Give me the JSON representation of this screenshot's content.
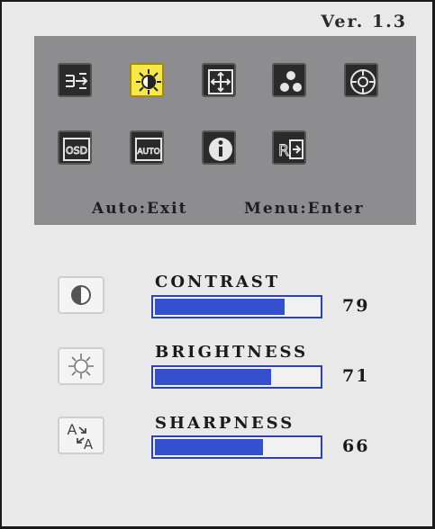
{
  "version": "Ver. 1.3",
  "menu": {
    "row1": [
      {
        "icon": "input-select-icon",
        "selected": false
      },
      {
        "icon": "picture-sun-icon",
        "selected": true
      },
      {
        "icon": "position-arrows-icon",
        "selected": false
      },
      {
        "icon": "color-dots-icon",
        "selected": false
      },
      {
        "icon": "image-setup-icon",
        "selected": false
      }
    ],
    "row2": [
      {
        "icon": "osd-setup-icon",
        "label": "OSD",
        "selected": false
      },
      {
        "icon": "auto-adjust-icon",
        "label": "AUTO",
        "selected": false
      },
      {
        "icon": "information-icon",
        "selected": false
      },
      {
        "icon": "reset-icon",
        "label": "R",
        "selected": false
      }
    ]
  },
  "hint": {
    "auto": "Auto:Exit",
    "menu": "Menu:Enter"
  },
  "settings": [
    {
      "label": "CONTRAST",
      "value": "79",
      "level": 79,
      "icon": "contrast-icon"
    },
    {
      "label": "BRIGHTNESS",
      "value": "71",
      "level": 71,
      "icon": "brightness-icon"
    },
    {
      "label": "SHARPNESS",
      "value": "66",
      "level": 66,
      "icon": "sharpness-icon"
    }
  ]
}
